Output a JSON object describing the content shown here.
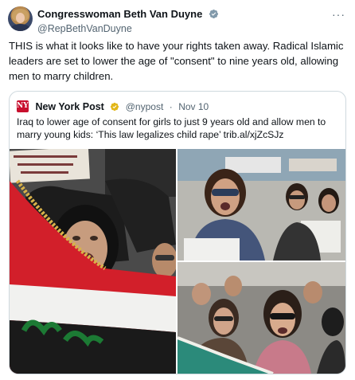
{
  "author": {
    "display_name": "Congresswoman Beth Van Duyne",
    "handle": "@RepBethVanDuyne",
    "verified_icon": "verified-badge-icon",
    "more_icon": "more-icon"
  },
  "tweet": {
    "text": "THIS is what it looks like to have your rights taken away. Radical Islamic leaders are set to lower the age of \"consent\" to nine years old, allowing men to marry children."
  },
  "quoted": {
    "logo_text": "NYP",
    "name": "New York Post",
    "handle": "@nypost",
    "date": "Nov 10",
    "text": "Iraq to lower age of consent for girls to just 9 years old and allow men to marry young kids: ‘This law legalizes child rape’ trib.al/xjZcSJz",
    "photos": [
      "protest-photo-flag",
      "protest-photo-woman-sunglasses",
      "protest-photo-crowd"
    ]
  },
  "colors": {
    "verified_blue": "#1d9bf0",
    "verified_gold": "#e2b719",
    "nyp_red": "#c8102e",
    "text_secondary": "#536471"
  }
}
